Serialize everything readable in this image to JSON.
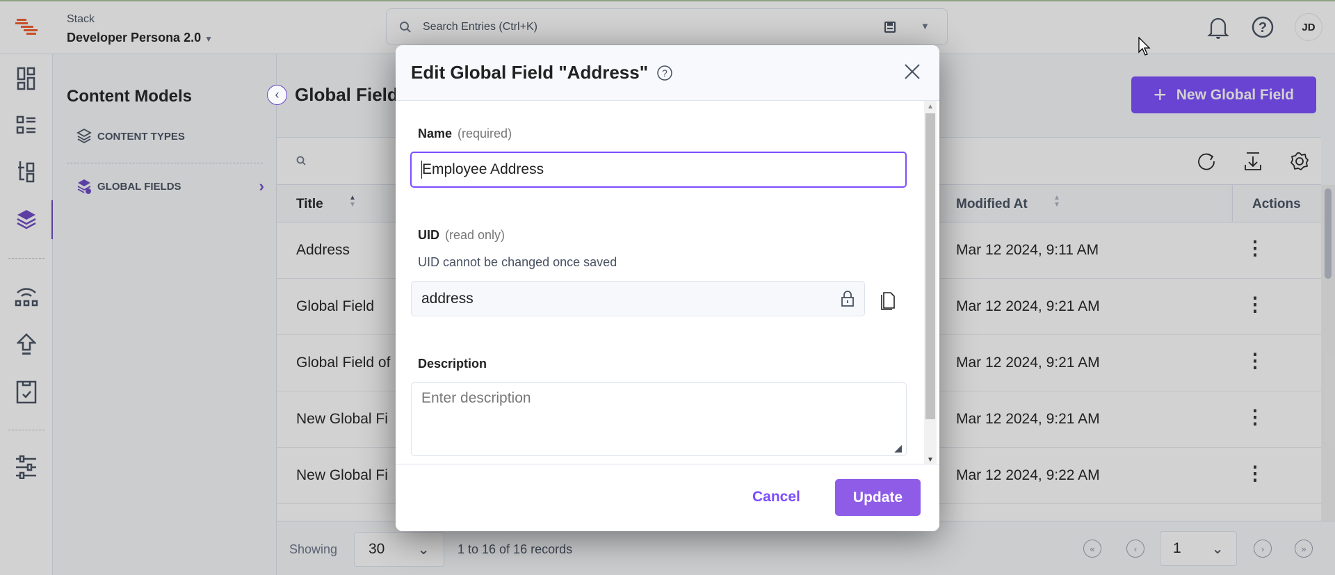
{
  "topbar": {
    "stack_label": "Stack",
    "stack_name": "Developer Persona 2.0",
    "search_placeholder": "Search Entries (Ctrl+K)",
    "avatar_initials": "JD"
  },
  "rail": {
    "icons": [
      "dashboard-icon",
      "entries-icon",
      "assets-icon",
      "content-models-icon",
      "releases-icon",
      "publish-queue-icon",
      "tasks-icon",
      "settings-icon"
    ],
    "active": "content-models-icon"
  },
  "sidebar": {
    "title": "Content Models",
    "items": [
      {
        "label": "CONTENT TYPES"
      },
      {
        "label": "GLOBAL FIELDS",
        "active": true
      }
    ]
  },
  "main": {
    "title": "Global Fields",
    "new_button": "New Global Field",
    "columns": {
      "title": "Title",
      "modified": "Modified At",
      "actions": "Actions"
    },
    "rows": [
      {
        "title": "Address",
        "modified": "Mar 12 2024, 9:11 AM"
      },
      {
        "title": "Global Field",
        "modified": "Mar 12 2024, 9:21 AM"
      },
      {
        "title": "Global Field of",
        "modified": "Mar 12 2024, 9:21 AM"
      },
      {
        "title": "New Global Fi",
        "modified": "Mar 12 2024, 9:21 AM"
      },
      {
        "title": "New Global Fi",
        "modified": "Mar 12 2024, 9:22 AM"
      }
    ],
    "footer": {
      "showing": "Showing",
      "per_page": "30",
      "records": "1 to 16 of 16 records",
      "page": "1"
    }
  },
  "modal": {
    "title": "Edit Global Field \"Address\"",
    "name_label": "Name",
    "name_hint": "(required)",
    "name_value": "Employee Address",
    "uid_label": "UID",
    "uid_hint": "(read only)",
    "uid_help": "UID cannot be changed once saved",
    "uid_value": "address",
    "desc_label": "Description",
    "desc_placeholder": "Enter description",
    "cancel": "Cancel",
    "update": "Update"
  },
  "colors": {
    "accent": "#6c5ce7",
    "brand_logo": "#f25c2a",
    "button": "#7c4dff"
  }
}
